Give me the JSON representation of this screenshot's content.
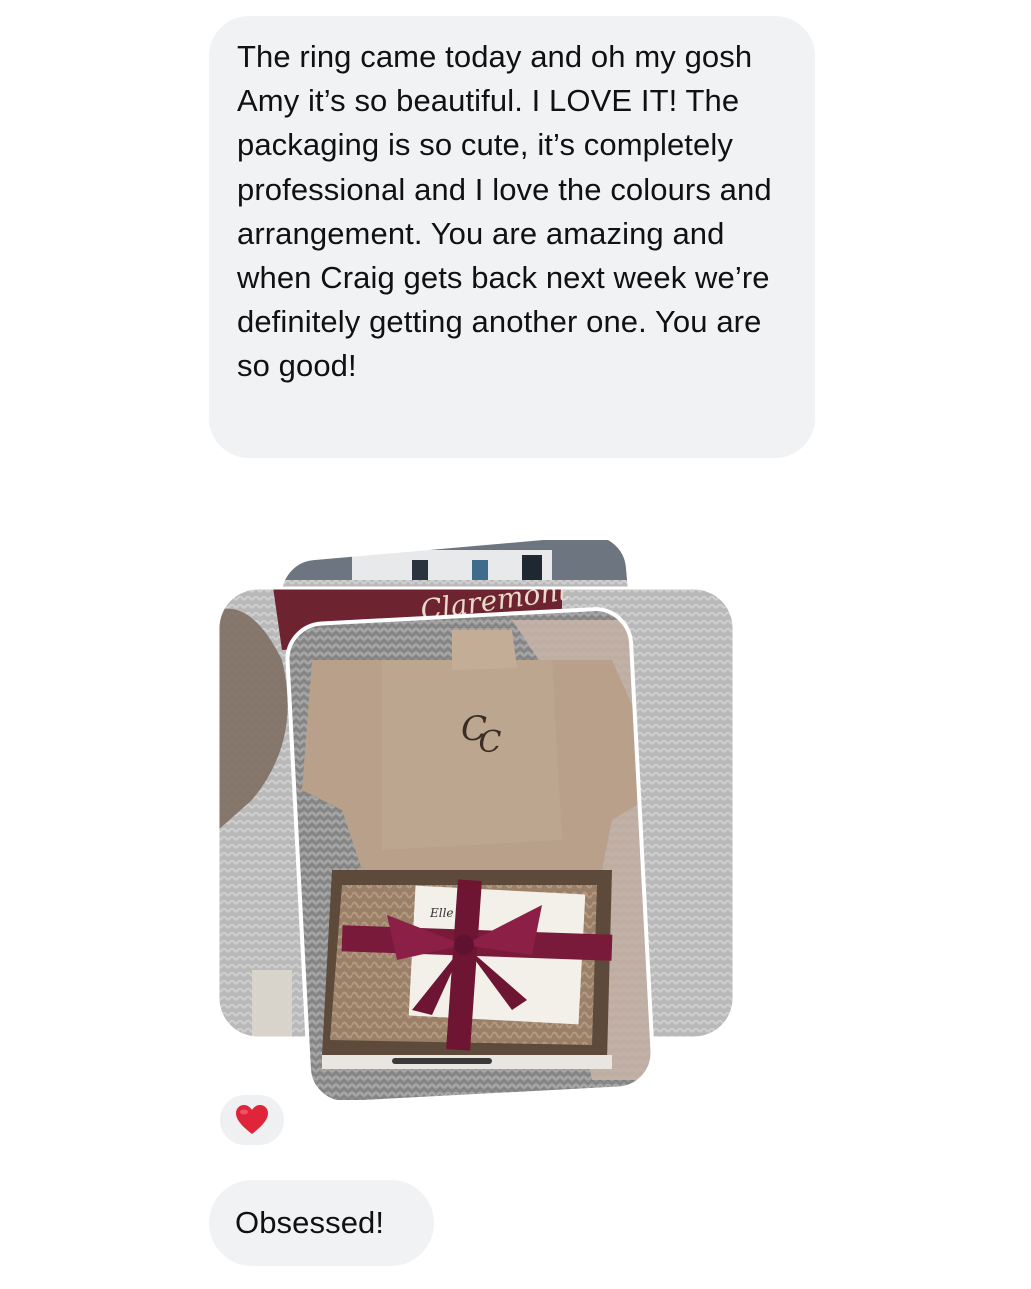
{
  "messages": [
    {
      "type": "text",
      "text": "The ring came today and oh my gosh Amy it’s so beautiful. I LOVE IT! The packaging is so cute, it’s completely professional and I love the colours and arrangement. You are amazing and when Craig gets back next week we’re definitely getting another one. You are so good!"
    },
    {
      "type": "photo_stack",
      "photo_count": 3,
      "description_icon": "photo-stack-icon"
    },
    {
      "type": "reaction",
      "emoji": "heart",
      "color": "#e0243a"
    },
    {
      "type": "text",
      "text": "Obsessed!"
    }
  ],
  "colors": {
    "bubble_bg": "#f0f2f3",
    "text": "#111111",
    "ribbon": "#7a1a3a",
    "cardboard": "#b49a80"
  }
}
